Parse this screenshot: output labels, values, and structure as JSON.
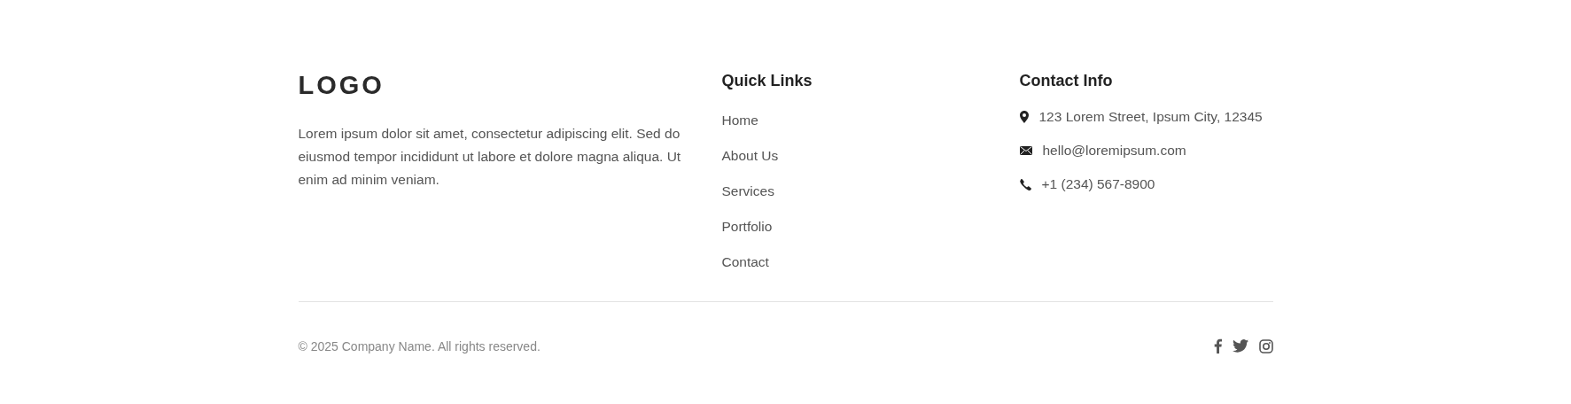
{
  "brand": {
    "logo": "LOGO",
    "description": "Lorem ipsum dolor sit amet, consectetur adipiscing elit. Sed do eiusmod tempor incididunt ut labore et dolore magna aliqua. Ut enim ad minim veniam."
  },
  "quick_links": {
    "title": "Quick Links",
    "items": [
      "Home",
      "About Us",
      "Services",
      "Portfolio",
      "Contact"
    ]
  },
  "contact_info": {
    "title": "Contact Info",
    "items": [
      {
        "kind": "address",
        "text": "123 Lorem Street, Ipsum City, 12345"
      },
      {
        "kind": "email",
        "text": "hello@loremipsum.com"
      },
      {
        "kind": "phone",
        "text": "+1 (234) 567-8900"
      }
    ]
  },
  "bottom_bar": {
    "copyright": "© 2025 Company Name. All rights reserved.",
    "social": [
      {
        "kind": "facebook"
      },
      {
        "kind": "twitter"
      },
      {
        "kind": "instagram"
      }
    ]
  }
}
